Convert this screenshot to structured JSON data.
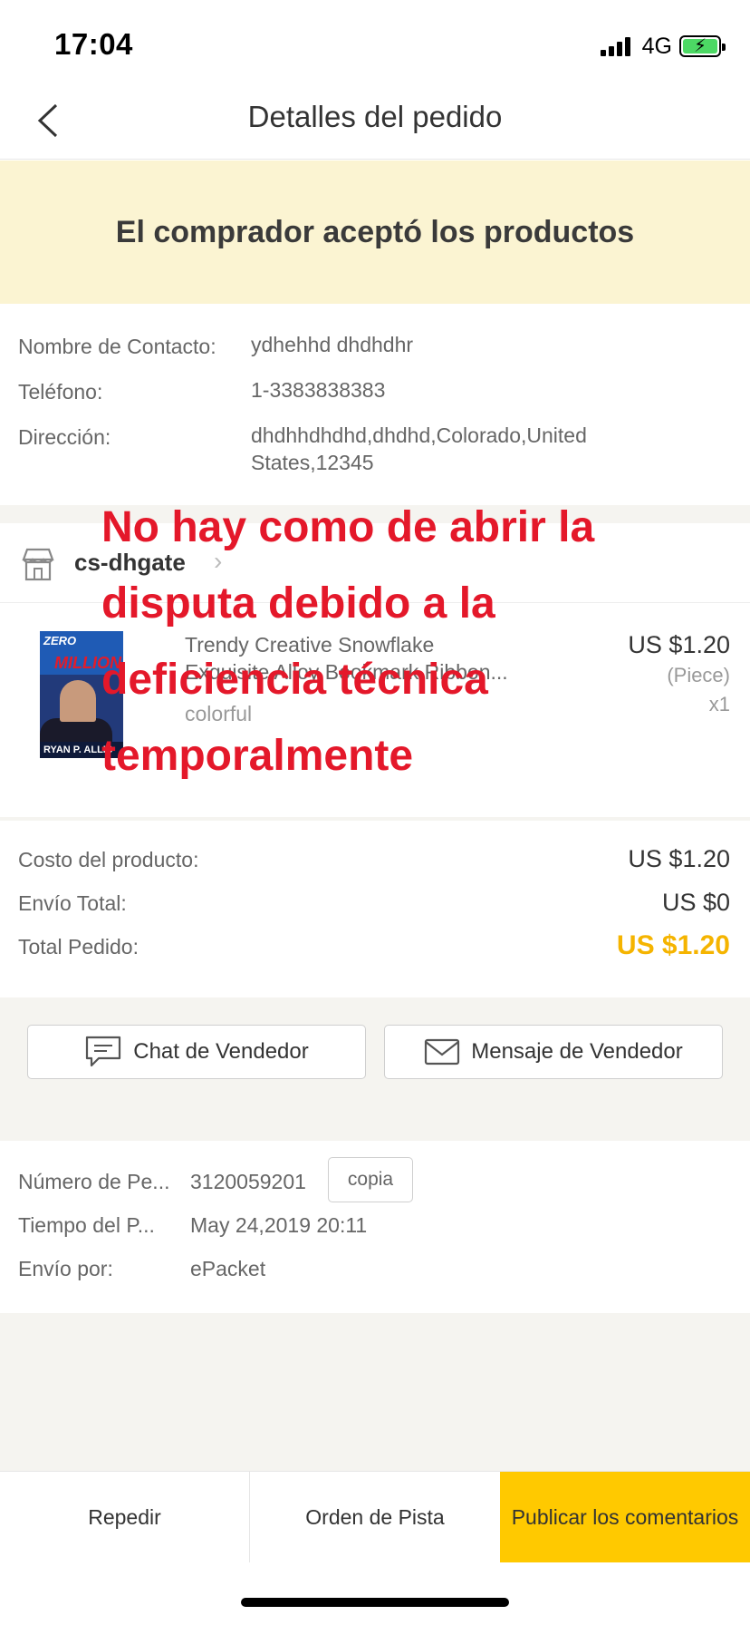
{
  "status_bar": {
    "time": "17:04",
    "network": "4G"
  },
  "nav": {
    "title": "Detalles del pedido"
  },
  "banner": {
    "text": "El comprador aceptó los productos"
  },
  "contact": {
    "name_label": "Nombre de Contacto:",
    "name_value": "ydhehhd dhdhdhr",
    "phone_label": "Teléfono:",
    "phone_value": "1-3383838383",
    "address_label": "Dirección:",
    "address_line1": "dhdhhdhdhd,dhdhd,Colorado,United",
    "address_line2": "States,12345"
  },
  "store": {
    "name": "cs-dhgate"
  },
  "product": {
    "thumb_top": "ZERO",
    "thumb_red": "MILLION",
    "thumb_bottom": "RYAN P. ALLIS",
    "title_line1": "Trendy Creative Snowflake",
    "title_line2": "Exquisite Alloy Bookmark Ribbon...",
    "variant": "colorful",
    "price": "US $1.20",
    "unit": "(Piece)",
    "quantity": "x1"
  },
  "summary": {
    "product_cost_label": "Costo del producto:",
    "product_cost": "US $1.20",
    "shipping_label": "Envío Total:",
    "shipping": "US $0",
    "total_label": "Total Pedido:",
    "total": "US $1.20"
  },
  "actions": {
    "chat_label": "Chat de Vendedor",
    "message_label": "Mensaje de Vendedor"
  },
  "order": {
    "number_label": "Número de Pe...",
    "number_value": "3120059201",
    "copy_label": "copia",
    "time_label": "Tiempo del P...",
    "time_value": "May 24,2019 20:11",
    "shipping_label": "Envío por:",
    "shipping_value": "ePacket"
  },
  "bottom_bar": {
    "reorder": "Repedir",
    "track": "Orden de Pista",
    "review": "Publicar los comentarios"
  },
  "overlay": {
    "line1": "No hay como de abrir la",
    "line2": "disputa debido a la",
    "line3": "deficiencia técnica",
    "line4": "temporalmente"
  },
  "colors": {
    "banner_bg": "#fbf4d2",
    "accent_yellow": "#ffc900",
    "total_price": "#f5b400",
    "overlay_red": "#e4182a",
    "battery_green": "#4cd964"
  }
}
